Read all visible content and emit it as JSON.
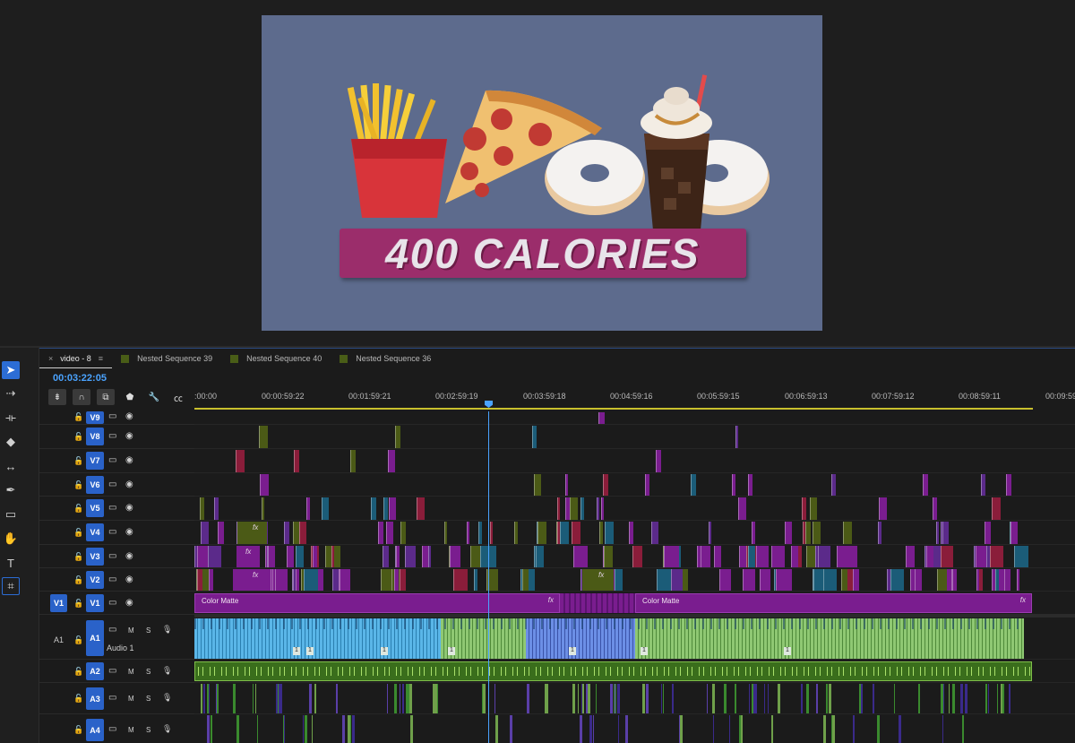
{
  "preview": {
    "banner_text": "400 CALORIES",
    "background_color": "#5d6b8d",
    "banner_color": "#9b2d6b"
  },
  "tabs": [
    {
      "label": "video - 8",
      "active": true,
      "close_glyph": "×",
      "menu_glyph": "≡"
    },
    {
      "label": "Nested Sequence 39",
      "active": false
    },
    {
      "label": "Nested Sequence 40",
      "active": false
    },
    {
      "label": "Nested Sequence 36",
      "active": false
    }
  ],
  "timecode": "00:03:22:05",
  "ruler_ticks": [
    ":00:00",
    "00:00:59:22",
    "00:01:59:21",
    "00:02:59:19",
    "00:03:59:18",
    "00:04:59:16",
    "00:05:59:15",
    "00:06:59:13",
    "00:07:59:12",
    "00:08:59:11",
    "00:09:59"
  ],
  "tools": [
    {
      "name": "selection-tool",
      "glyph": "➤"
    },
    {
      "name": "track-select-tool",
      "glyph": "⇢"
    },
    {
      "name": "ripple-edit-tool",
      "glyph": "⟛"
    },
    {
      "name": "razor-tool",
      "glyph": "◆"
    },
    {
      "name": "slip-tool",
      "glyph": "↔"
    },
    {
      "name": "pen-tool",
      "glyph": "✒"
    },
    {
      "name": "rectangle-tool",
      "glyph": "▭"
    },
    {
      "name": "hand-tool",
      "glyph": "✋"
    },
    {
      "name": "type-tool",
      "glyph": "T"
    },
    {
      "name": "remix-tool",
      "glyph": "⌗"
    }
  ],
  "video_tracks": [
    {
      "id": "V9",
      "label": "V9"
    },
    {
      "id": "V8",
      "label": "V8"
    },
    {
      "id": "V7",
      "label": "V7"
    },
    {
      "id": "V6",
      "label": "V6"
    },
    {
      "id": "V5",
      "label": "V5"
    },
    {
      "id": "V4",
      "label": "V4"
    },
    {
      "id": "V3",
      "label": "V3"
    },
    {
      "id": "V2",
      "label": "V2"
    },
    {
      "id": "V1",
      "label": "V1",
      "source": "V1"
    }
  ],
  "audio_tracks": [
    {
      "id": "A1",
      "label": "A1",
      "source": "A1",
      "name": "Audio 1"
    },
    {
      "id": "A2",
      "label": "A2"
    },
    {
      "id": "A3",
      "label": "A3"
    },
    {
      "id": "A4",
      "label": "A4"
    }
  ],
  "track_buttons": {
    "mute": "M",
    "solo": "S"
  },
  "clips": {
    "color_matte_1": "Color Matte",
    "color_matte_2": "Color Matte",
    "fx": "fx",
    "audio_badge": "1"
  },
  "colors": {
    "accent": "#2a62c9",
    "playhead": "#4aa3ff",
    "video_clip": "#7a1d8f",
    "video_clip_alt": "#5b2a8a",
    "nested_clip": "#4b5a16",
    "teal_clip": "#1b5c78",
    "red_clip": "#8a1d3a",
    "audio_blue": "#5ab6e8",
    "audio_green": "#8fc873",
    "audio_indigo": "#5b7fd8",
    "audio_wave_green": "#3a8a2e"
  }
}
